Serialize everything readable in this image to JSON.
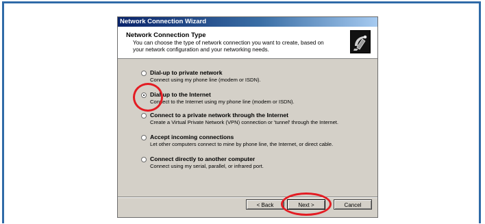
{
  "window": {
    "title": "Network Connection Wizard"
  },
  "header": {
    "title": "Network Connection Type",
    "description": "You can choose the type of network connection you want to create, based on your network configuration and your networking needs.",
    "icon": "network-wizard-icon"
  },
  "options": [
    {
      "label": "Dial-up to private network",
      "description": "Connect using my phone line (modem or ISDN).",
      "selected": false
    },
    {
      "label": "Dial-up to the Internet",
      "description": "Connect to the Internet using my phone line (modem or ISDN).",
      "selected": true
    },
    {
      "label": "Connect to a private network through the Internet",
      "description": "Create a Virtual Private Network (VPN) connection or 'tunnel' through the Internet.",
      "selected": false
    },
    {
      "label": "Accept incoming connections",
      "description": "Let other computers connect to mine by phone line, the Internet, or direct cable.",
      "selected": false
    },
    {
      "label": "Connect directly to another computer",
      "description": "Connect using my serial, parallel, or infrared port.",
      "selected": false
    }
  ],
  "buttons": {
    "back": "< Back",
    "next": "Next >",
    "cancel": "Cancel"
  },
  "colors": {
    "frame": "#2f6aa7",
    "annotation": "#e31c23",
    "dialog": "#d4d0c8"
  }
}
